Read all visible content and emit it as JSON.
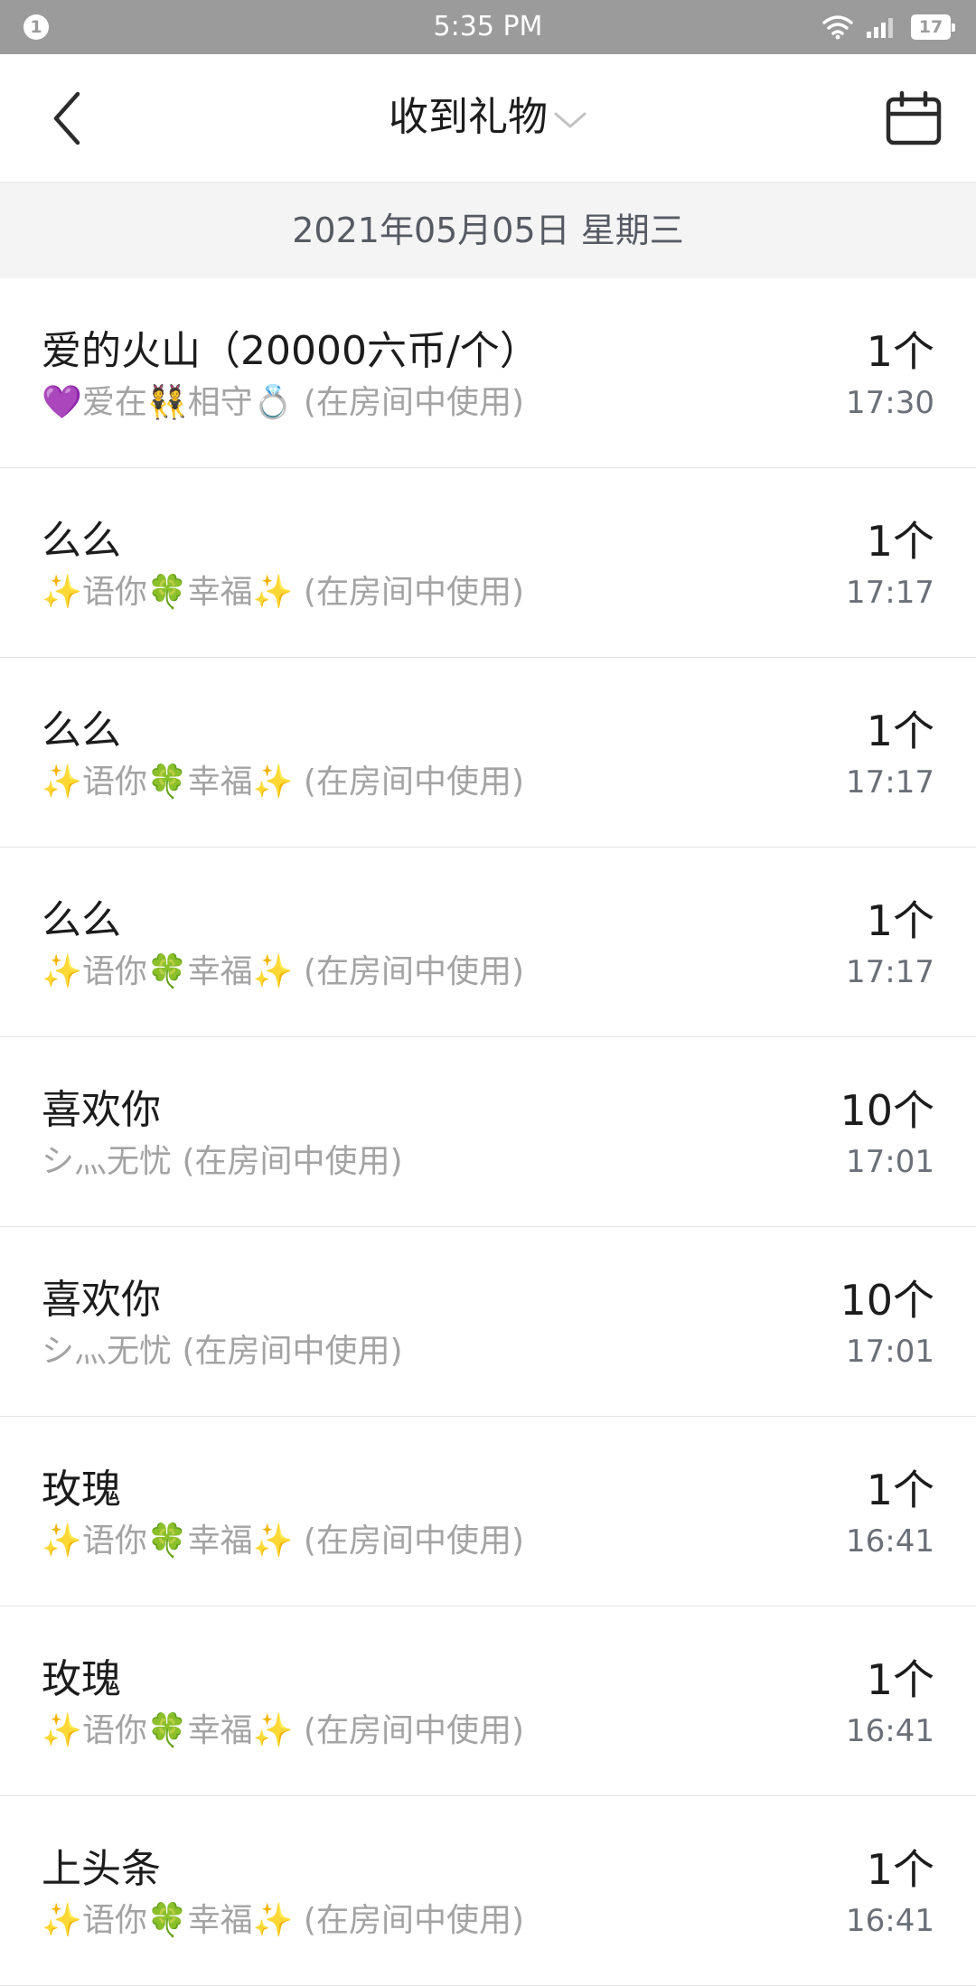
{
  "status_bar": {
    "notification_count": "1",
    "time": "5:35 PM",
    "battery_level": "17"
  },
  "nav": {
    "title": "收到礼物"
  },
  "date_header": "2021年05月05日 星期三",
  "gifts": [
    {
      "name": "爱的火山（20000六币/个）",
      "sender": "💜爱在👯相守💍 (在房间中使用)",
      "count": "1个",
      "time": "17:30"
    },
    {
      "name": "么么",
      "sender": "✨语你🍀幸福✨ (在房间中使用)",
      "count": "1个",
      "time": "17:17"
    },
    {
      "name": "么么",
      "sender": "✨语你🍀幸福✨ (在房间中使用)",
      "count": "1个",
      "time": "17:17"
    },
    {
      "name": "么么",
      "sender": "✨语你🍀幸福✨ (在房间中使用)",
      "count": "1个",
      "time": "17:17"
    },
    {
      "name": "喜欢你",
      "sender": "シ灬无忧 (在房间中使用)",
      "count": "10个",
      "time": "17:01"
    },
    {
      "name": "喜欢你",
      "sender": "シ灬无忧 (在房间中使用)",
      "count": "10个",
      "time": "17:01"
    },
    {
      "name": "玫瑰",
      "sender": "✨语你🍀幸福✨ (在房间中使用)",
      "count": "1个",
      "time": "16:41"
    },
    {
      "name": "玫瑰",
      "sender": "✨语你🍀幸福✨ (在房间中使用)",
      "count": "1个",
      "time": "16:41"
    },
    {
      "name": "上头条",
      "sender": "✨语你🍀幸福✨ (在房间中使用)",
      "count": "1个",
      "time": "16:41"
    }
  ]
}
